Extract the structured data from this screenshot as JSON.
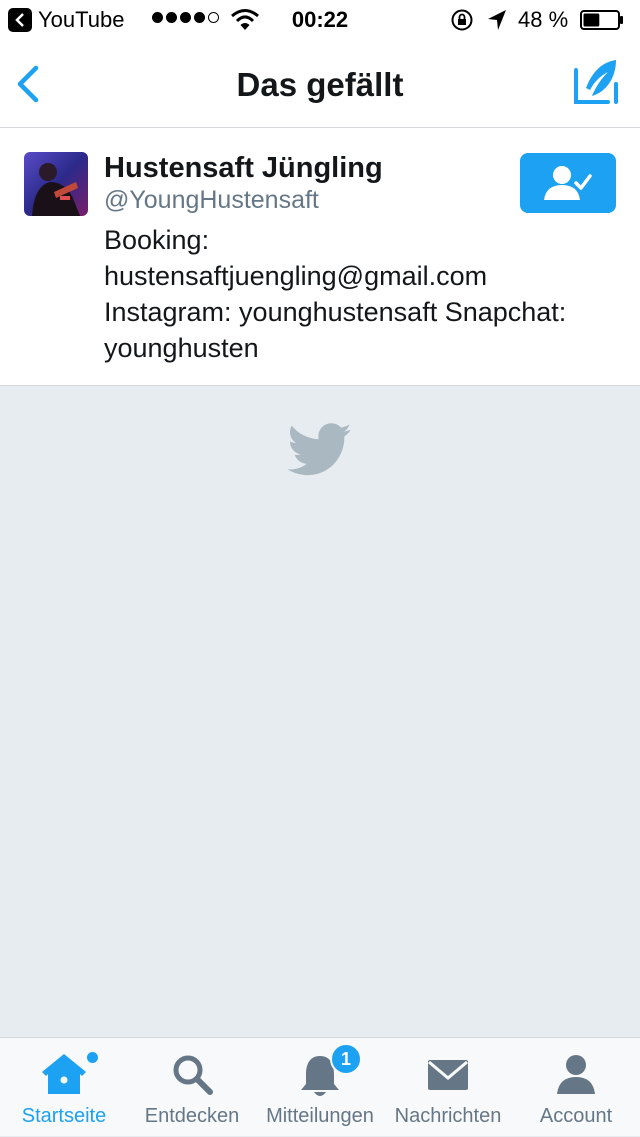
{
  "status_bar": {
    "back_app": "YouTube",
    "time": "00:22",
    "battery": "48 %",
    "battery_level": 0.48,
    "signal_bars": 4
  },
  "nav": {
    "title": "Das gefällt",
    "back_icon": "chevron-left-icon",
    "compose_icon": "compose-quill-icon"
  },
  "user": {
    "name": "Hustensaft Jüngling",
    "handle": "@YoungHustensaft",
    "bio_lines": [
      "Booking:",
      "hustensaftjuengling@gmail.com",
      "Instagram: younghustensaft Snapchat:",
      "younghusten"
    ],
    "following": true,
    "follow_icon": "person-check-icon"
  },
  "loading": {
    "icon": "twitter-bird-icon"
  },
  "tabs": [
    {
      "label": "Startseite",
      "icon": "home-icon",
      "active": true,
      "dot": true
    },
    {
      "label": "Entdecken",
      "icon": "search-icon",
      "active": false
    },
    {
      "label": "Mitteilungen",
      "icon": "bell-icon",
      "active": false,
      "badge": "1"
    },
    {
      "label": "Nachrichten",
      "icon": "envelope-icon",
      "active": false
    },
    {
      "label": "Account",
      "icon": "person-icon",
      "active": false
    }
  ],
  "colors": {
    "accent": "#1da1f2",
    "background": "#e6ecf0",
    "secondary_text": "#657786",
    "inactive_icon": "#657786"
  }
}
